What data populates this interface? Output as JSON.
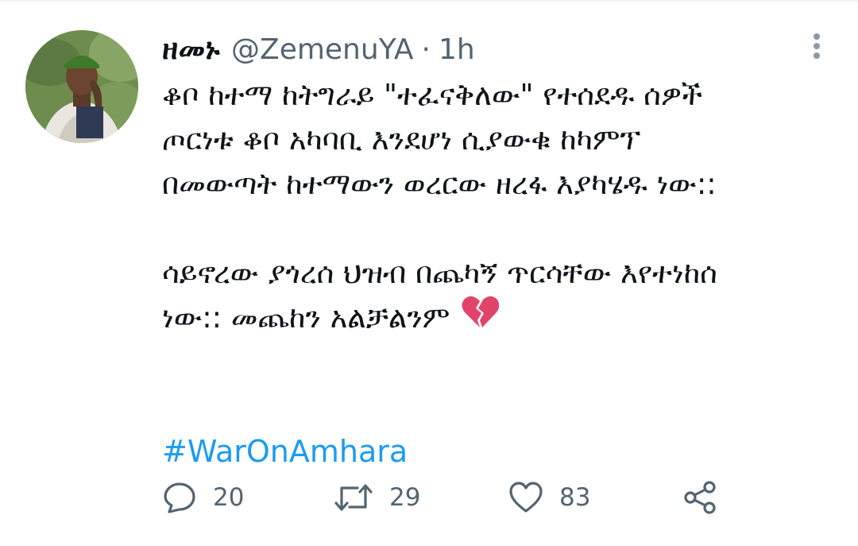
{
  "tweet": {
    "display_name": "ዘመኑ",
    "handle": "@ZemenuYA",
    "separator": "·",
    "time": "1h",
    "text_lines": [
      "ቆቦ ከተማ ከትግራይ \"ተፈናቅለው\" የተሰደዱ ሰዎች",
      "ጦርነቱ ቆቦ አካባቢ እንደሆነ ሲያውቁ ከካምፕ",
      "በመውጣት ከተማውን ወረርው ዘረፋ እያካሄዱ ነው::",
      "ሳይኖረው ያጎረሰ ህዝብ በጨካኝ ጥርሳቸው እየተነከሰ",
      "ነው:: መጨከን አልቻልንም"
    ],
    "emoji": "broken-heart",
    "hashtag": "#WarOnAmhara",
    "stats": {
      "replies": "20",
      "retweets": "29",
      "likes": "83"
    }
  },
  "icons": {
    "more": "vertical-dots-icon",
    "reply": "reply-icon",
    "retweet": "retweet-icon",
    "like": "like-heart-icon",
    "share": "share-icon"
  },
  "colors": {
    "accent": "#1d9bf0",
    "muted": "#536471",
    "text": "#0f1419",
    "broken_heart": "#e0446a"
  }
}
